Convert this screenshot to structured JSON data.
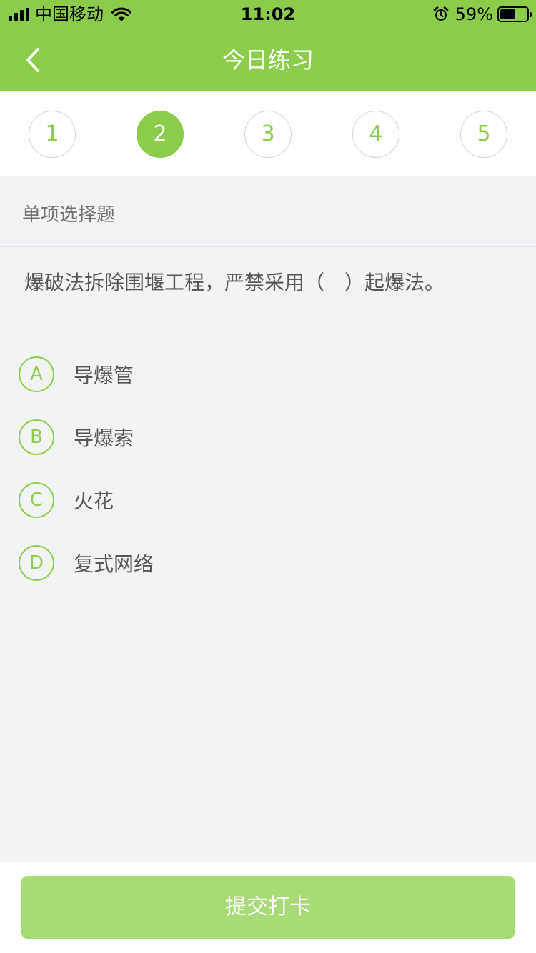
{
  "status_bar": {
    "carrier": "中国移动",
    "time": "11:02",
    "battery_percent": "59%",
    "battery_level": 0.59,
    "icons": [
      "signal-icon",
      "wifi-icon",
      "alarm-icon",
      "battery-icon"
    ]
  },
  "nav": {
    "title": "今日练习",
    "back_icon": "chevron-left-icon"
  },
  "question_tabs": [
    {
      "label": "1",
      "active": false
    },
    {
      "label": "2",
      "active": true
    },
    {
      "label": "3",
      "active": false
    },
    {
      "label": "4",
      "active": false
    },
    {
      "label": "5",
      "active": false
    }
  ],
  "question": {
    "type": "单项选择题",
    "text": "爆破法拆除围堰工程，严禁采用（　）起爆法。",
    "options": [
      {
        "letter": "A",
        "text": "导爆管"
      },
      {
        "letter": "B",
        "text": "导爆索"
      },
      {
        "letter": "C",
        "text": "火花"
      },
      {
        "letter": "D",
        "text": "复式网络"
      }
    ]
  },
  "submit": {
    "label": "提交打卡"
  },
  "colors": {
    "brand_green": "#8bcd4a",
    "submit_green": "#a8db76",
    "background": "#f2f3f5"
  }
}
